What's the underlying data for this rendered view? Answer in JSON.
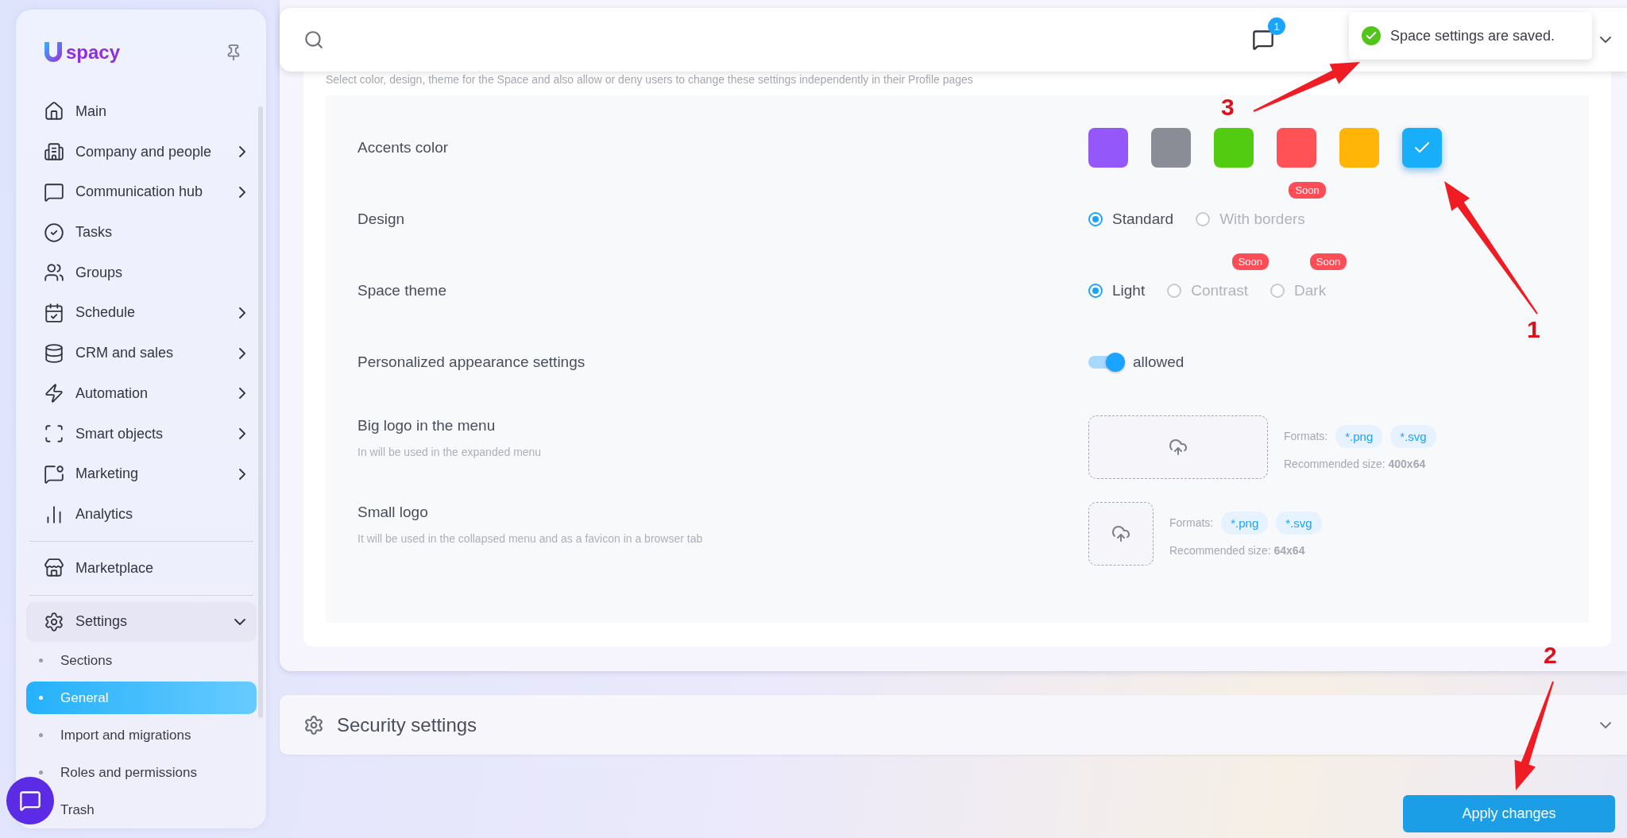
{
  "sidebar": {
    "logo_text": "spacy",
    "items": [
      {
        "label": "Main",
        "expandable": false
      },
      {
        "label": "Company and people",
        "expandable": true
      },
      {
        "label": "Communication hub",
        "expandable": true
      },
      {
        "label": "Tasks",
        "expandable": false
      },
      {
        "label": "Groups",
        "expandable": false
      },
      {
        "label": "Schedule",
        "expandable": true
      },
      {
        "label": "CRM and sales",
        "expandable": true
      },
      {
        "label": "Automation",
        "expandable": true
      },
      {
        "label": "Smart objects",
        "expandable": true
      },
      {
        "label": "Marketing",
        "expandable": true
      },
      {
        "label": "Analytics",
        "expandable": false
      },
      {
        "label": "Marketplace",
        "expandable": false
      },
      {
        "label": "Settings",
        "expandable": true,
        "expanded": true,
        "children": [
          {
            "label": "Sections",
            "selected": false
          },
          {
            "label": "General",
            "selected": true
          },
          {
            "label": "Import and migrations",
            "selected": false
          },
          {
            "label": "Roles and permissions",
            "selected": false
          },
          {
            "label": "Trash",
            "selected": false
          }
        ]
      }
    ]
  },
  "header": {
    "notifications_badge": "1"
  },
  "toast": {
    "message": "Space settings are saved."
  },
  "appearance": {
    "description": "Select color, design, theme for the Space and also allow or deny users to change these settings independently in their Profile pages",
    "rows": [
      {
        "kind": "swatches",
        "label": "Accents color",
        "swatches": [
          {
            "color": "#9457fa",
            "selected": false
          },
          {
            "color": "#8b8d96",
            "selected": false
          },
          {
            "color": "#52cc10",
            "selected": false
          },
          {
            "color": "#ff5257",
            "selected": false
          },
          {
            "color": "#ffb508",
            "selected": false
          },
          {
            "color": "#18aefa",
            "selected": true
          }
        ]
      },
      {
        "kind": "radio",
        "label": "Design",
        "options": [
          {
            "label": "Standard",
            "selected": true,
            "disabled": false
          },
          {
            "label": "With borders",
            "selected": false,
            "disabled": true,
            "badge": "Soon"
          }
        ]
      },
      {
        "kind": "radio",
        "label": "Space theme",
        "options": [
          {
            "label": "Light",
            "selected": true,
            "disabled": false
          },
          {
            "label": "Contrast",
            "selected": false,
            "disabled": true,
            "badge": "Soon"
          },
          {
            "label": "Dark",
            "selected": false,
            "disabled": true,
            "badge": "Soon"
          }
        ]
      },
      {
        "kind": "toggle",
        "label": "Personalized appearance settings",
        "on": true,
        "value": "allowed"
      },
      {
        "kind": "banner",
        "label": "Big logo in the menu",
        "hint": "In will be used in the expanded menu",
        "formats_label": "Formats:",
        "formats": [
          "*.png",
          "*.svg"
        ],
        "recommended": "Recommended size: **400x64**"
      },
      {
        "kind": "square",
        "label": "Small logo",
        "hint": "It will be used in the collapsed menu and as a favicon in a browser tab",
        "formats_label": "Formats:",
        "formats": [
          "*.png",
          "*.svg"
        ],
        "recommended": "Recommended size: **64x64**"
      }
    ]
  },
  "security": {
    "title": "Security settings",
    "expanded": false
  },
  "apply_button": "Apply changes",
  "annotations": [
    {
      "label": "1"
    },
    {
      "label": "2"
    },
    {
      "label": "3"
    }
  ]
}
